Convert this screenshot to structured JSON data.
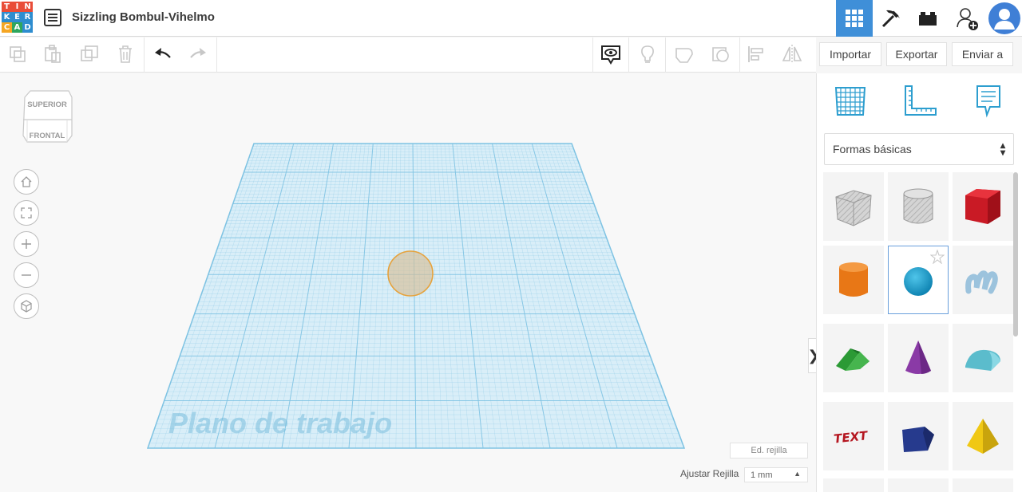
{
  "app": {
    "logo_letters": [
      "T",
      "I",
      "N",
      "K",
      "E",
      "R",
      "C",
      "A",
      "D"
    ],
    "logo_colors": [
      "#e94d38",
      "#e94d38",
      "#e94d38",
      "#2e8dcf",
      "#2e8dcf",
      "#2e8dcf",
      "#f5a623",
      "#2ea65d",
      "#2e8dcf"
    ],
    "design_title": "Sizzling Bombul-Vihelmo",
    "accent_color": "#3f8fd8"
  },
  "topbar": {
    "icons": [
      "3d-design-icon",
      "pickaxe-icon",
      "bricks-icon",
      "add-user-icon",
      "avatar-icon"
    ],
    "active": "3d-design-icon"
  },
  "toolbar": {
    "actions": [
      "copy-icon",
      "paste-icon",
      "duplicate-icon",
      "delete-icon",
      "undo-icon",
      "redo-icon",
      "notes-icon",
      "light-icon",
      "shape-solid-icon",
      "shape-hole-icon",
      "align-icon",
      "mirror-icon"
    ],
    "import_label": "Importar",
    "export_label": "Exportar",
    "send_label": "Enviar a"
  },
  "viewcube": {
    "top_label": "SUPERIOR",
    "front_label": "FRONTAL"
  },
  "nav_buttons": [
    "home-icon",
    "fit-icon",
    "zoom-in-icon",
    "zoom-out-icon",
    "perspective-icon"
  ],
  "workplane": {
    "label": "Plano de trabajo",
    "edit_grid": "Ed. rejilla",
    "snap_label": "Ajustar Rejilla",
    "snap_value": "1 mm",
    "grid_color": "#7fc3e3"
  },
  "panel": {
    "icons": [
      "workplane-icon",
      "ruler-icon",
      "notes-icon"
    ],
    "category": "Formas básicas",
    "shapes": [
      {
        "name": "box-hole",
        "color": "#b8b8b8"
      },
      {
        "name": "cylinder-hole",
        "color": "#c8c8c8"
      },
      {
        "name": "box",
        "color": "#d6202b"
      },
      {
        "name": "cylinder",
        "color": "#ef7f1a"
      },
      {
        "name": "sphere",
        "color": "#1aa3d4"
      },
      {
        "name": "scribble",
        "color": "#9fc7e0"
      },
      {
        "name": "roof",
        "color": "#2ea03a"
      },
      {
        "name": "cone",
        "color": "#8c3fa8"
      },
      {
        "name": "round-roof",
        "color": "#6ec8d8"
      },
      {
        "name": "text",
        "color": "#d6202b"
      },
      {
        "name": "polygon",
        "color": "#2a3f94"
      },
      {
        "name": "pyramid",
        "color": "#f2cc1b"
      }
    ],
    "selected_shape": "sphere"
  }
}
